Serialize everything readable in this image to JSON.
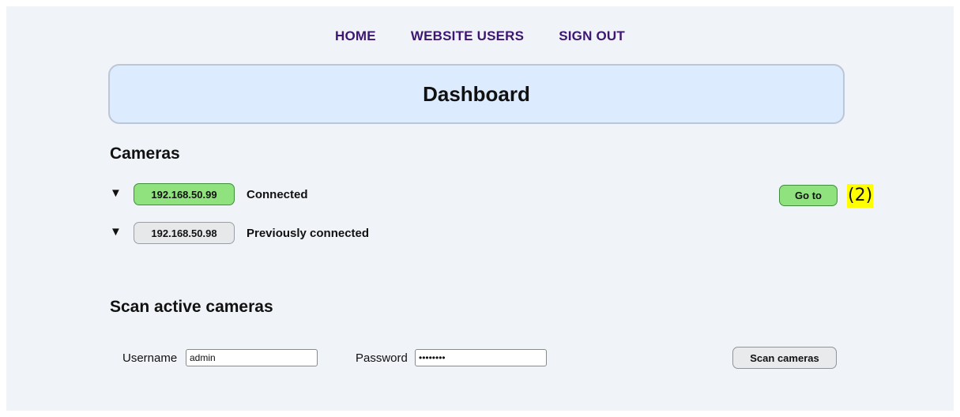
{
  "nav": {
    "home": "HOME",
    "website_users": "WEBSITE USERS",
    "sign_out": "SIGN OUT"
  },
  "header": {
    "title": "Dashboard"
  },
  "cameras": {
    "title": "Cameras",
    "items": [
      {
        "toggle": "▼",
        "ip": "192.168.50.99",
        "status": "Connected",
        "state": "connected",
        "goto_label": "Go to",
        "count_label": "(2)"
      },
      {
        "toggle": "▼",
        "ip": "192.168.50.98",
        "status": "Previously connected",
        "state": "previous"
      }
    ]
  },
  "scan": {
    "title": "Scan active cameras",
    "username_label": "Username",
    "username_value": "admin",
    "password_label": "Password",
    "password_value": "password",
    "button_label": "Scan cameras"
  },
  "colors": {
    "nav_text": "#3c1670",
    "header_bg": "#dcebfd",
    "connected_green": "#8fe27d",
    "previous_gray": "#e7e8ea",
    "highlight": "#ffff00",
    "page_bg": "#f0f3f8"
  }
}
